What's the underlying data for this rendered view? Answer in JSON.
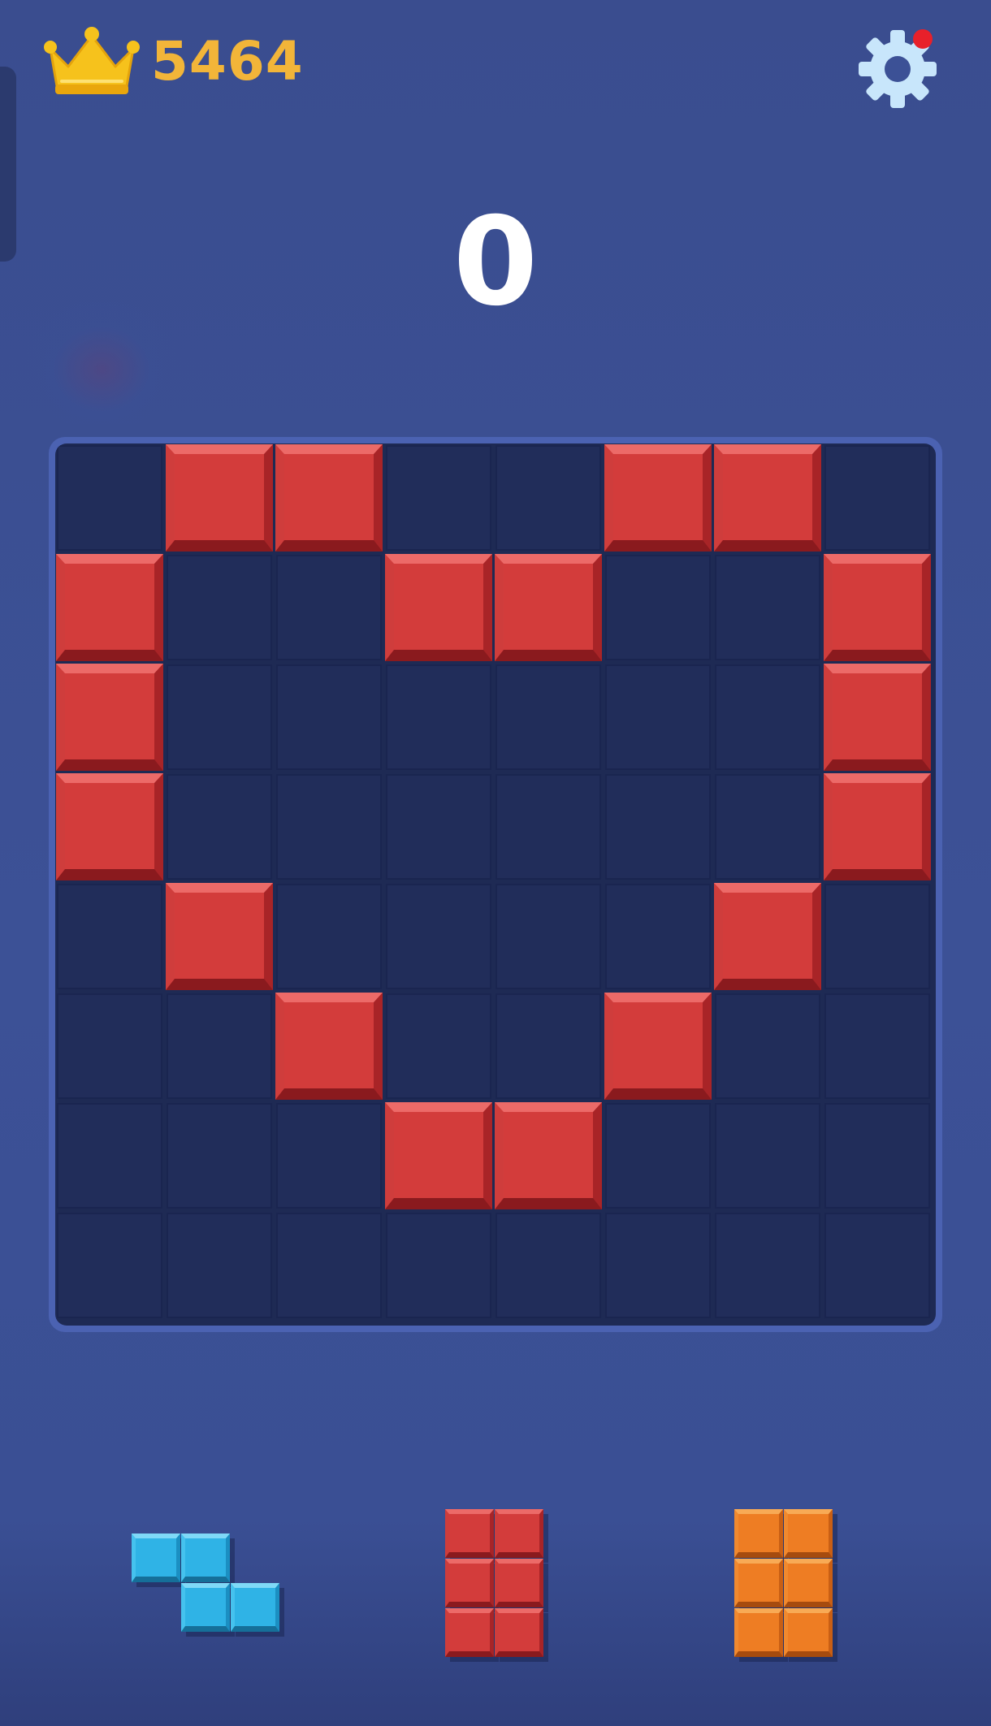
{
  "header": {
    "best_score": "5464",
    "crown_icon": "crown-icon",
    "settings_icon": "gear-icon",
    "settings_notification": true
  },
  "score": {
    "current": "0"
  },
  "board": {
    "rows": 8,
    "cols": 8,
    "filled_cells": [
      [
        0,
        1
      ],
      [
        0,
        2
      ],
      [
        0,
        5
      ],
      [
        0,
        6
      ],
      [
        1,
        0
      ],
      [
        1,
        3
      ],
      [
        1,
        4
      ],
      [
        1,
        7
      ],
      [
        2,
        0
      ],
      [
        2,
        7
      ],
      [
        3,
        0
      ],
      [
        3,
        7
      ],
      [
        4,
        1
      ],
      [
        4,
        6
      ],
      [
        5,
        2
      ],
      [
        5,
        5
      ],
      [
        6,
        3
      ],
      [
        6,
        4
      ]
    ],
    "filled_color": "red"
  },
  "tray": {
    "pieces": [
      {
        "name": "piece-blue-z",
        "color": "blue",
        "cells": [
          [
            0,
            0
          ],
          [
            0,
            1
          ],
          [
            1,
            1
          ],
          [
            1,
            2
          ]
        ]
      },
      {
        "name": "piece-red-2x3",
        "color": "red",
        "cells": [
          [
            0,
            0
          ],
          [
            0,
            1
          ],
          [
            1,
            0
          ],
          [
            1,
            1
          ],
          [
            2,
            0
          ],
          [
            2,
            1
          ]
        ]
      },
      {
        "name": "piece-orange-2x3",
        "color": "orange",
        "cells": [
          [
            0,
            0
          ],
          [
            0,
            1
          ],
          [
            1,
            0
          ],
          [
            1,
            1
          ],
          [
            2,
            0
          ],
          [
            2,
            1
          ]
        ]
      }
    ]
  },
  "colors": {
    "background": "#3c5196",
    "board": "#1e2a54",
    "board_frame": "#4b62b2",
    "score_gold": "#f2b539",
    "gear": "#c8e6fb",
    "notification": "#e8202a",
    "red_block": "#d33c3b",
    "blue_block": "#2fb3e6",
    "orange_block": "#ee7d23"
  }
}
